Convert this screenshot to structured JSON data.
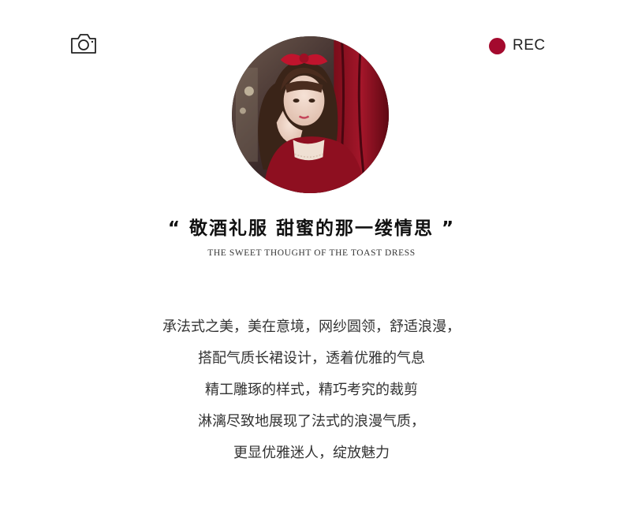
{
  "header": {
    "camera_icon": "camera-icon",
    "rec_label": "REC",
    "rec_color": "#a40a2e"
  },
  "portrait": {
    "alt": "Model in a red velvet dress with a red hair bow"
  },
  "headline": {
    "text": "“ 敬酒礼服   甜蜜的那一缕情思 ”"
  },
  "subtitle": {
    "text": "THE SWEET THOUGHT OF THE TOAST DRESS"
  },
  "body": {
    "lines": [
      "承法式之美，美在意境，网纱圆领，舒适浪漫，",
      "搭配气质长裙设计，透着优雅的气息",
      "精工雕琢的样式，精巧考究的裁剪",
      "淋漓尽致地展现了法式的浪漫气质，",
      "更显优雅迷人，绽放魅力"
    ]
  }
}
